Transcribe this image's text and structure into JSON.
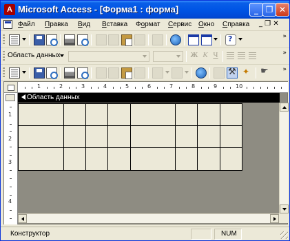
{
  "window": {
    "title": "Microsoft Access - [Форма1 : форма]",
    "app_icon_letter": "A"
  },
  "menubar": {
    "items": [
      {
        "label": "Файл",
        "ul": "Ф",
        "rest": "айл"
      },
      {
        "label": "Правка",
        "ul": "П",
        "rest": "равка"
      },
      {
        "label": "Вид",
        "ul": "В",
        "rest": "ид"
      },
      {
        "label": "Вставка",
        "ul": "В",
        "rest": "ставка"
      },
      {
        "label": "Формат",
        "ul": "о",
        "pre": "Ф",
        "rest": "рмат"
      },
      {
        "label": "Сервис",
        "ul": "С",
        "rest": "ервис"
      },
      {
        "label": "Окно",
        "ul": "О",
        "rest": "кно"
      },
      {
        "label": "Справка",
        "ul": "С",
        "rest": "правка"
      }
    ],
    "mdi_controls": "_ ❐ ✕"
  },
  "format_toolbar": {
    "object_selector": "Область данных"
  },
  "design": {
    "section_label": "Область данных",
    "ruler_h": [
      "1",
      "2",
      "3",
      "4",
      "5",
      "6",
      "7",
      "8",
      "9",
      "10"
    ],
    "ruler_v": [
      "1",
      "2",
      "3",
      "4"
    ]
  },
  "statusbar": {
    "mode": "Конструктор",
    "num": "NUM"
  },
  "colors": {
    "titlebar": "#0055e5",
    "chrome": "#ece9d8",
    "workspace": "#8e8c82",
    "section_bar": "#000000"
  }
}
